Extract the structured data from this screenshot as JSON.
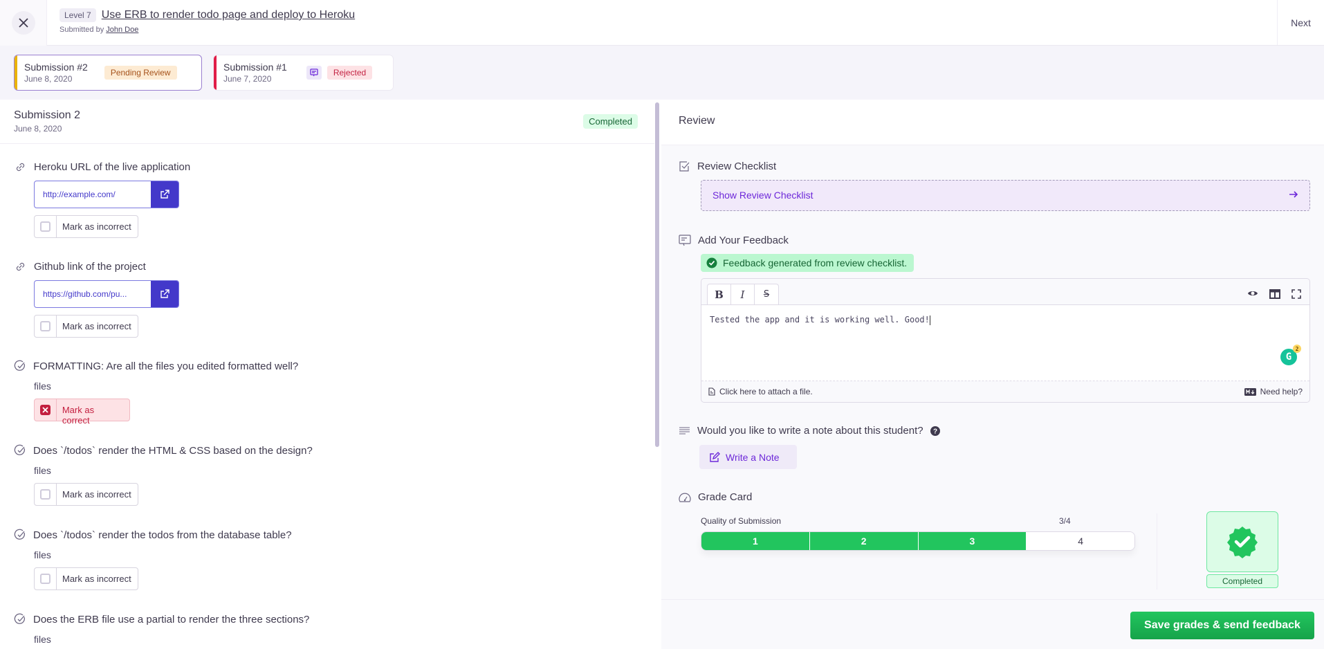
{
  "header": {
    "level": "Level 7",
    "title": "Use ERB to render todo page and deploy to Heroku",
    "submitted_by_prefix": "Submitted by",
    "submitter": "John Doe",
    "next_label": "Next"
  },
  "submissions": [
    {
      "name": "Submission #2",
      "date": "June 8, 2020",
      "status": "Pending Review",
      "stripe_color": "#eab308",
      "active": true
    },
    {
      "name": "Submission #1",
      "date": "June 7, 2020",
      "status": "Rejected",
      "stripe_color": "#e11d48",
      "active": false,
      "has_comment": true
    }
  ],
  "submission_detail": {
    "title": "Submission 2",
    "date": "June 8, 2020",
    "status": "Completed",
    "items": [
      {
        "type": "link",
        "question": "Heroku URL of the live application",
        "value": "http://example.com/",
        "mark_label": "Mark as incorrect",
        "marked_incorrect": false
      },
      {
        "type": "link",
        "question": "Github link of the project",
        "value": "https://github.com/pu...",
        "mark_label": "Mark as incorrect",
        "marked_incorrect": false
      },
      {
        "type": "check",
        "question": "FORMATTING: Are all the files you edited formatted well?",
        "answer": "files",
        "mark_label": "Mark as correct",
        "marked_incorrect": true
      },
      {
        "type": "check",
        "question": "Does `/todos` render the HTML & CSS based on the design?",
        "answer": "files",
        "mark_label": "Mark as incorrect",
        "marked_incorrect": false
      },
      {
        "type": "check",
        "question": "Does `/todos` render the todos from the database table?",
        "answer": "files",
        "mark_label": "Mark as incorrect",
        "marked_incorrect": false
      },
      {
        "type": "check",
        "question": "Does the ERB file use a partial to render the three sections?",
        "answer": "files"
      }
    ]
  },
  "review": {
    "title": "Review",
    "checklist_heading": "Review Checklist",
    "checklist_button": "Show Review Checklist",
    "feedback_heading": "Add Your Feedback",
    "feedback_notice": "Feedback generated from review checklist.",
    "editor": {
      "bold": "B",
      "italic": "I",
      "strike": "S",
      "content": "Tested the app and it is working well. Good!",
      "attach_label": "Click here to attach a file.",
      "help_label": "Need help?",
      "grammarly_count": "2"
    },
    "note_question": "Would you like to write a note about this student?",
    "note_button": "Write a Note",
    "grade_heading": "Grade Card",
    "grade": {
      "criterion": "Quality of Submission",
      "score": 3,
      "max": 4,
      "score_label": "3/4",
      "options": [
        "1",
        "2",
        "3",
        "4"
      ]
    },
    "result_label": "Completed",
    "save_button": "Save grades & send feedback"
  },
  "colors": {
    "accent": "#4338ca",
    "purple": "#6d28d9",
    "success": "#22c55e",
    "danger": "#c31f3f"
  }
}
